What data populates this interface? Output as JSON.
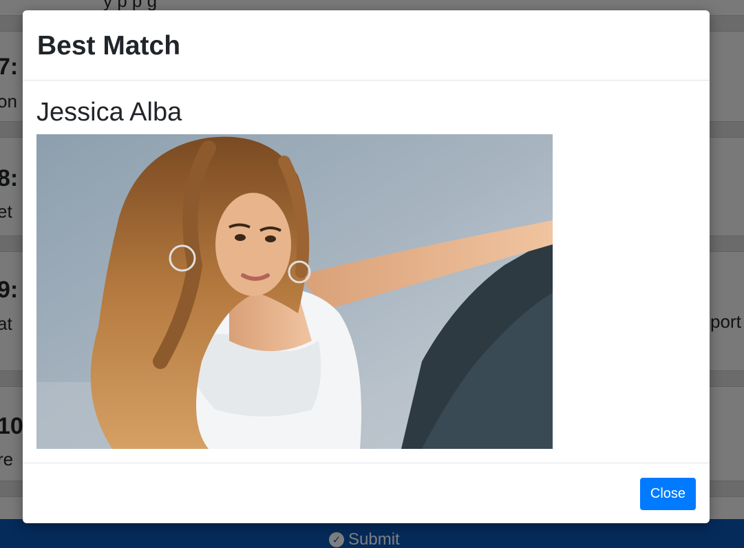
{
  "background": {
    "top_text": "y                                   p   p           g",
    "questions": [
      {
        "label": "7:",
        "text": "on"
      },
      {
        "label": "8:",
        "text": "et"
      },
      {
        "label": "9:",
        "text": "at"
      },
      {
        "label": "10",
        "text": "re"
      }
    ],
    "right_fragment": "port",
    "submit_label": "Submit",
    "submit_icon": "check-circle-icon",
    "colors": {
      "submit_bar": "#0a56b6"
    }
  },
  "modal": {
    "title": "Best Match",
    "match_name": "Jessica Alba",
    "photo_alt": "photo",
    "close_label": "Close",
    "colors": {
      "primary_button": "#007bff",
      "divider": "#dee2e6"
    }
  }
}
